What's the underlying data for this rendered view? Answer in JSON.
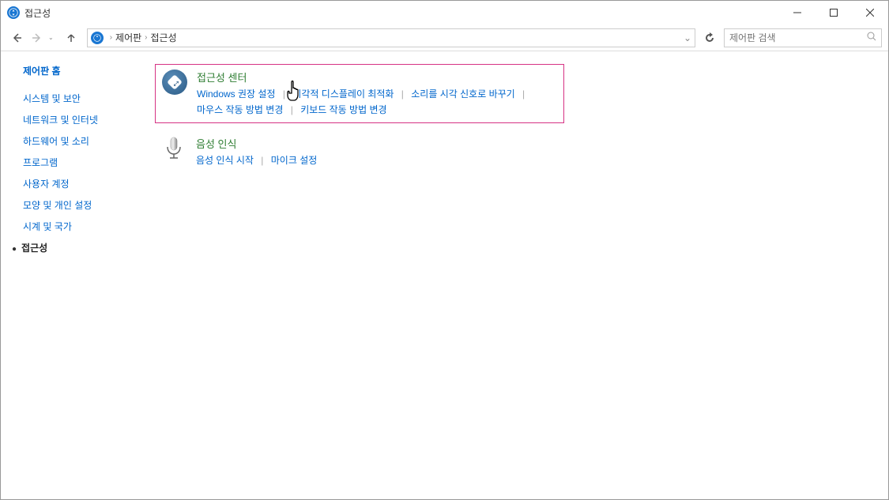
{
  "window": {
    "title": "접근성"
  },
  "breadcrumb": {
    "items": [
      "제어판",
      "접근성"
    ]
  },
  "search": {
    "placeholder": "제어판 검색"
  },
  "sidebar": {
    "home": "제어판 홈",
    "items": [
      "시스템 및 보안",
      "네트워크 및 인터넷",
      "하드웨어 및 소리",
      "프로그램",
      "사용자 계정",
      "모양 및 개인 설정",
      "시계 및 국가"
    ],
    "active": "접근성"
  },
  "categories": {
    "accessibility": {
      "title": "접근성 센터",
      "links": [
        "Windows 권장 설정",
        "시각적 디스플레이 최적화",
        "소리를 시각 신호로 바꾸기",
        "마우스 작동 방법 변경",
        "키보드 작동 방법 변경"
      ]
    },
    "speech": {
      "title": "음성 인식",
      "links": [
        "음성 인식 시작",
        "마이크 설정"
      ]
    }
  }
}
